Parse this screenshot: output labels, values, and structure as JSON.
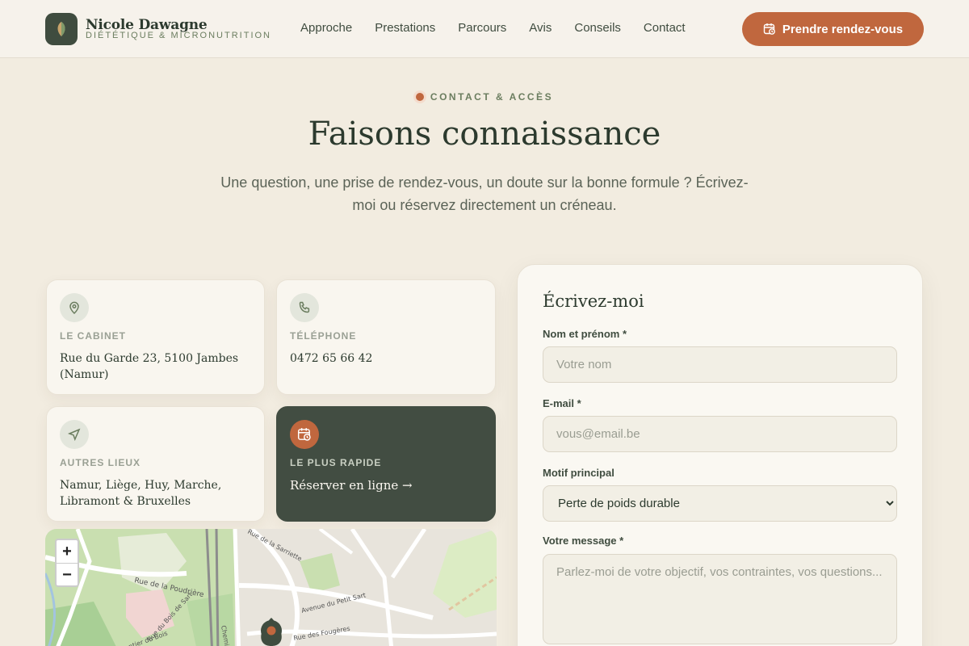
{
  "brand": {
    "name": "Nicole Dawagne",
    "tagline": "DIÉTÉTIQUE & MICRONUTRITION"
  },
  "nav": {
    "items": [
      "Approche",
      "Prestations",
      "Parcours",
      "Avis",
      "Conseils",
      "Contact"
    ]
  },
  "cta": {
    "label": "Prendre rendez-vous"
  },
  "hero": {
    "eyebrow": "CONTACT & ACCÈS",
    "title": "Faisons connaissance",
    "lead": "Une question, une prise de rendez-vous, un doute sur la bonne formule ? Écrivez-moi ou réservez directement un créneau."
  },
  "cards": [
    {
      "label": "LE CABINET",
      "value": "Rue du Garde 23, 5100 Jambes (Namur)",
      "icon": "map-pin-icon"
    },
    {
      "label": "TÉLÉPHONE",
      "value": "0472 65 66 42",
      "icon": "phone-icon"
    },
    {
      "label": "AUTRES LIEUX",
      "value": "Namur, Liège, Huy, Marche, Libramont & Bruxelles",
      "icon": "navigation-icon"
    },
    {
      "label": "LE PLUS RAPIDE",
      "value": "Réserver en ligne →",
      "icon": "calendar-clock-icon"
    }
  ],
  "map": {
    "zoom_in": "+",
    "zoom_out": "−",
    "streets": [
      "Rue de la Poudrière",
      "Rue du Bois de Sart",
      "Rue de la Sarriette",
      "Avenue du Petit Sart",
      "Rue des Fougères",
      "Sentier du Bois",
      "Chemin"
    ]
  },
  "form": {
    "title": "Écrivez-moi",
    "name_label": "Nom et prénom *",
    "name_placeholder": "Votre nom",
    "email_label": "E-mail *",
    "email_placeholder": "vous@email.be",
    "motif_label": "Motif principal",
    "motif_selected": "Perte de poids durable",
    "message_label": "Votre message *",
    "message_placeholder": "Parlez-moi de votre objectif, vos contraintes, vos questions..."
  },
  "colors": {
    "accent": "#c0673e",
    "dark": "#424d42",
    "background": "#f2ece0"
  }
}
